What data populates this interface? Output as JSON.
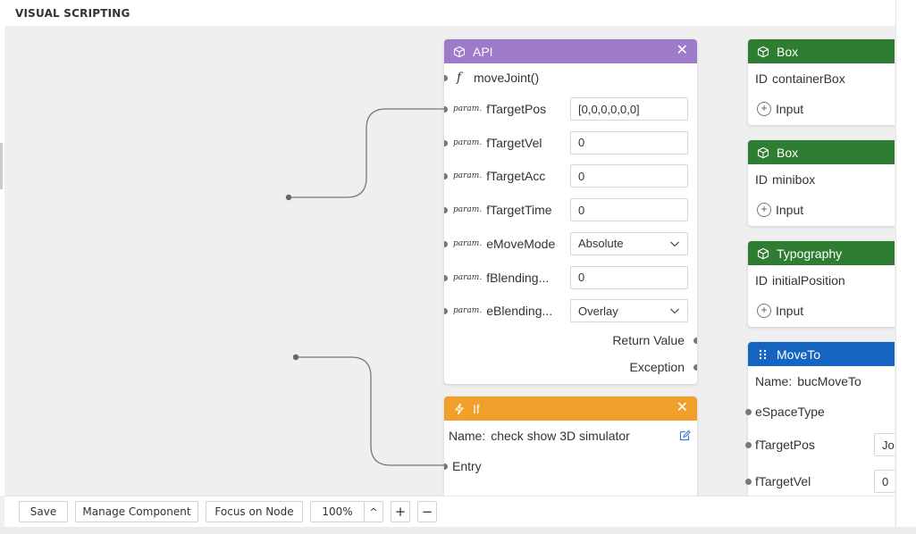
{
  "header": {
    "title": "VISUAL SCRIPTING"
  },
  "api_node": {
    "title": "API",
    "function_name": "moveJoint()",
    "param_word": "param.",
    "params": [
      {
        "name": "fTargetPos",
        "value": "[0,0,0,0,0,0]",
        "type": "input"
      },
      {
        "name": "fTargetVel",
        "value": "0",
        "type": "input"
      },
      {
        "name": "fTargetAcc",
        "value": "0",
        "type": "input"
      },
      {
        "name": "fTargetTime",
        "value": "0",
        "type": "input"
      },
      {
        "name": "eMoveMode",
        "value": "Absolute",
        "type": "select"
      },
      {
        "name": "fBlending...",
        "value": "0",
        "type": "input"
      },
      {
        "name": "eBlending...",
        "value": "Overlay",
        "type": "select"
      }
    ],
    "outputs": [
      "Return Value",
      "Exception"
    ]
  },
  "if_node": {
    "title": "If",
    "name_label": "Name:",
    "name_value": "check show 3D simulator",
    "entry_label": "Entry"
  },
  "box_nodes": [
    {
      "title": "Box",
      "id_label": "ID",
      "id_value": "containerBox",
      "input_label": "Input"
    },
    {
      "title": "Box",
      "id_label": "ID",
      "id_value": "minibox",
      "input_label": "Input"
    },
    {
      "title": "Typography",
      "id_label": "ID",
      "id_value": "initialPosition",
      "input_label": "Input"
    }
  ],
  "moveto_node": {
    "title": "MoveTo",
    "name_label": "Name:",
    "name_value": "bucMoveTo",
    "ports": [
      "eSpaceType",
      "fTargetPos",
      "fTargetVel"
    ],
    "partial_values": [
      "Jo",
      "0"
    ]
  },
  "toolbar": {
    "save": "Save",
    "manage_component": "Manage Component",
    "focus_on_node": "Focus on Node",
    "zoom": "100%",
    "zoom_up": "^",
    "zoom_in": "+",
    "zoom_out": "−"
  },
  "colors": {
    "api_header": "#9d7bca",
    "box_header": "#2e7d32",
    "if_header": "#f0a02a",
    "moveto_header": "#1565c0",
    "edit_icon": "#3b7dd8"
  },
  "icons": {
    "cube": "cube-icon",
    "function": "function-icon",
    "bolt": "bolt-icon",
    "grip": "grip-icon",
    "close": "close-icon",
    "edit": "edit-icon"
  }
}
